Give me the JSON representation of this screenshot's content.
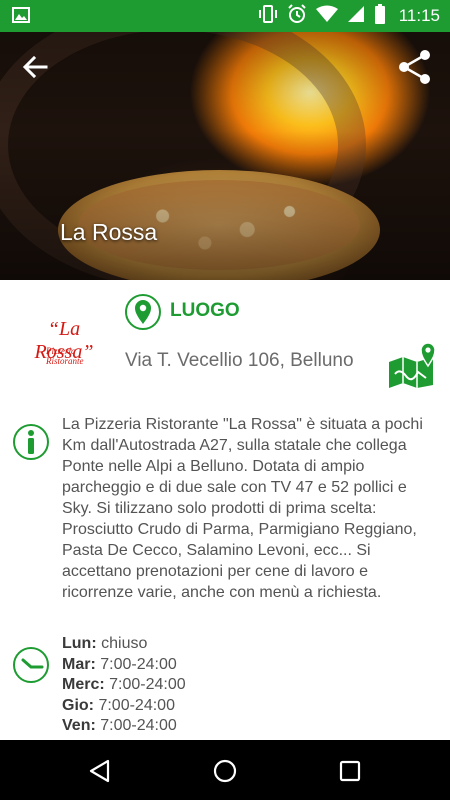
{
  "status_bar": {
    "time": "11:15",
    "icons": [
      "image-icon",
      "vibrate-icon",
      "alarm-icon",
      "wifi-icon",
      "signal-icon",
      "battery-icon"
    ]
  },
  "header": {
    "title": "La Rossa",
    "back_icon": "arrow-left-icon",
    "share_icon": "share-icon"
  },
  "logo": {
    "name": "“La Rossa”",
    "subtitle": "Pizzeria Ristorante"
  },
  "location": {
    "label": "LUOGO",
    "address": "Via T. Vecellio 106, Belluno"
  },
  "description": "La Pizzeria Ristorante \"La Rossa\" è situata a pochi Km dall'Autostrada A27, sulla statale che collega Ponte nelle Alpi a Belluno. Dotata di ampio parcheggio e di due sale con TV 47 e 52 pollici e Sky. Si tilizzano solo prodotti di prima scelta: Prosciutto Crudo di Parma, Parmigiano Reggiano, Pasta De Cecco, Salamino Levoni, ecc... Si accettano prenotazioni per cene di lavoro e ricorrenze varie, anche con menù a richiesta.",
  "hours": [
    {
      "day": "Lun:",
      "time": "chiuso"
    },
    {
      "day": "Mar:",
      "time": "7:00-24:00"
    },
    {
      "day": "Merc:",
      "time": "7:00-24:00"
    },
    {
      "day": "Gio:",
      "time": "7:00-24:00"
    },
    {
      "day": "Ven:",
      "time": "7:00-24:00"
    }
  ],
  "colors": {
    "accent": "#1e9c32",
    "logo_red": "#d51a14",
    "text": "#545454"
  },
  "nav": {
    "back": "nav-back-icon",
    "home": "nav-home-icon",
    "recents": "nav-recents-icon"
  }
}
